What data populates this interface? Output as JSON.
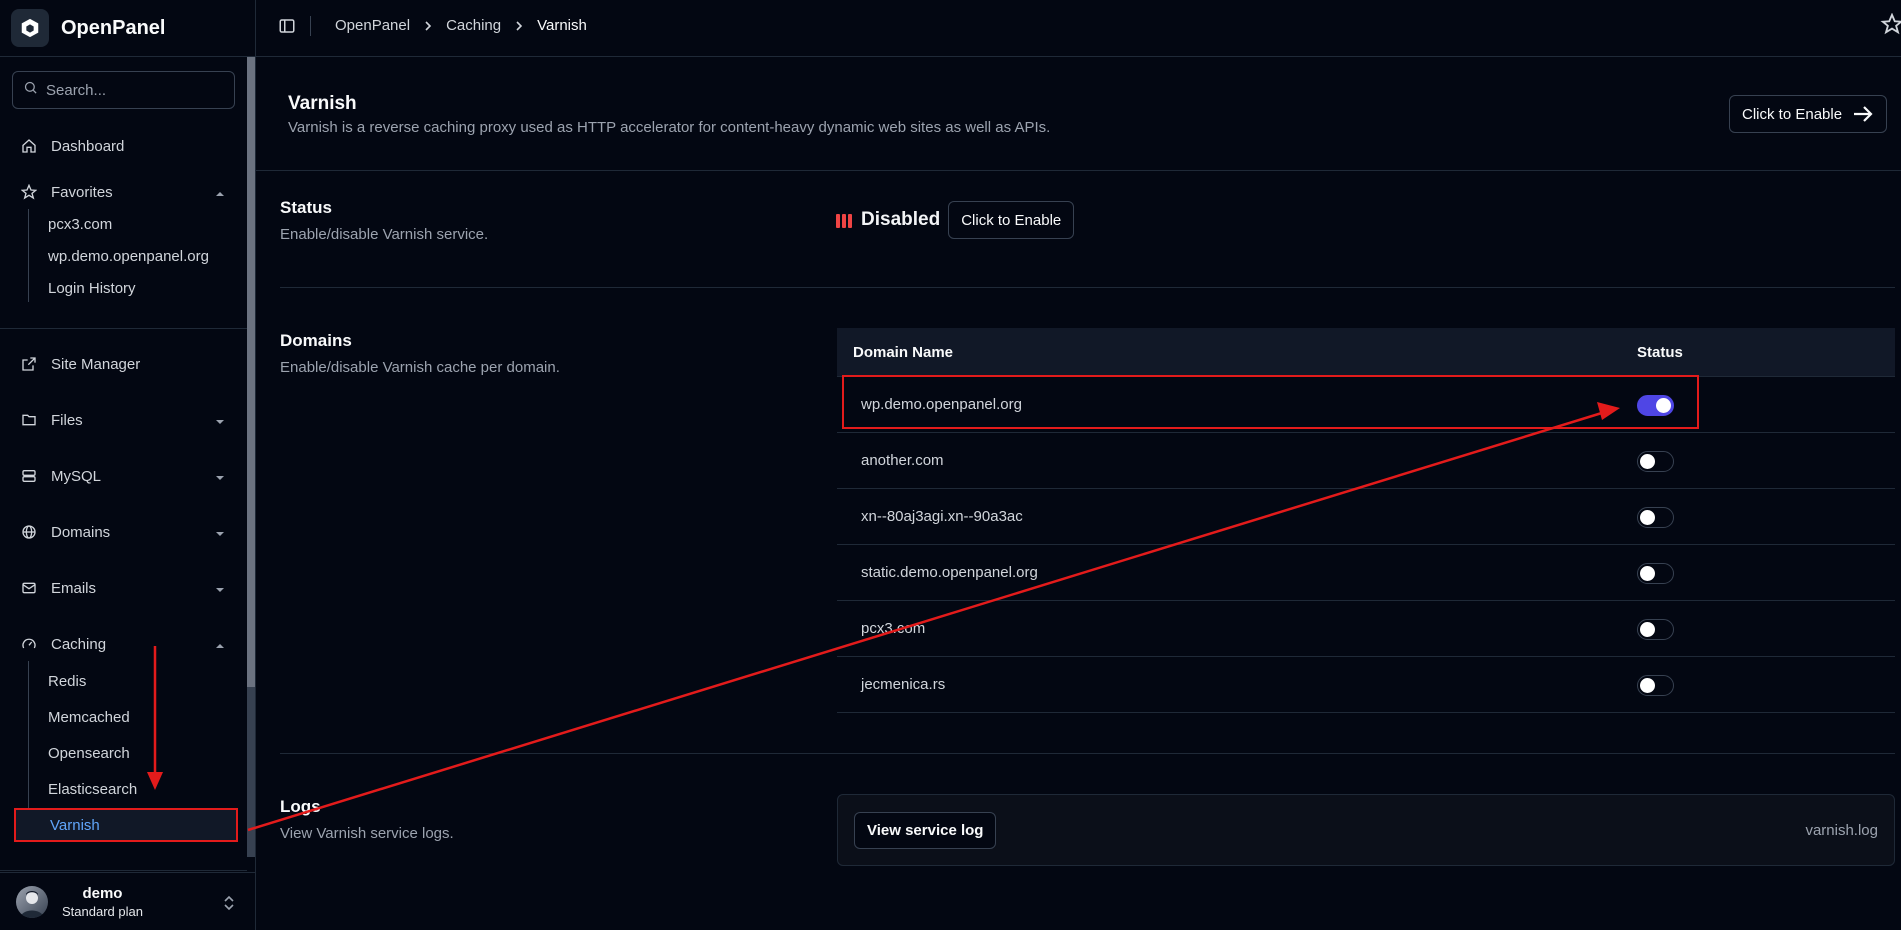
{
  "brand": {
    "name": "OpenPanel"
  },
  "sidebar": {
    "search_placeholder": "Search...",
    "dashboard": "Dashboard",
    "favorites": {
      "label": "Favorites",
      "items": [
        "pcx3.com",
        "wp.demo.openpanel.org",
        "Login History"
      ]
    },
    "site_manager": "Site Manager",
    "files": "Files",
    "mysql": "MySQL",
    "domains": "Domains",
    "emails": "Emails",
    "caching": {
      "label": "Caching",
      "items": [
        "Redis",
        "Memcached",
        "Opensearch",
        "Elasticsearch",
        "Varnish"
      ]
    },
    "user": {
      "name": "demo",
      "plan": "Standard plan"
    }
  },
  "breadcrumb": [
    "OpenPanel",
    "Caching",
    "Varnish"
  ],
  "page": {
    "title": "Varnish",
    "description": "Varnish is a reverse caching proxy used as HTTP accelerator for content-heavy dynamic web sites as well as APIs.",
    "enable_button": "Click to Enable"
  },
  "status_section": {
    "title": "Status",
    "description": "Enable/disable Varnish service.",
    "value": "Disabled",
    "button": "Click to Enable",
    "status_color": "#ef4444"
  },
  "domains_section": {
    "title": "Domains",
    "description": "Enable/disable Varnish cache per domain.",
    "columns": [
      "Domain Name",
      "Status"
    ],
    "rows": [
      {
        "domain": "wp.demo.openpanel.org",
        "enabled": true
      },
      {
        "domain": "another.com",
        "enabled": false
      },
      {
        "domain": "xn--80aj3agi.xn--90a3ac",
        "enabled": false
      },
      {
        "domain": "static.demo.openpanel.org",
        "enabled": false
      },
      {
        "domain": "pcx3.com",
        "enabled": false
      },
      {
        "domain": "jecmenica.rs",
        "enabled": false
      }
    ]
  },
  "logs_section": {
    "title": "Logs",
    "description": "View Varnish service logs.",
    "button": "View service log",
    "file": "varnish.log"
  },
  "colors": {
    "accent": "#4f46e5",
    "annotation": "#e31b1b",
    "active_link": "#60a5fa"
  }
}
